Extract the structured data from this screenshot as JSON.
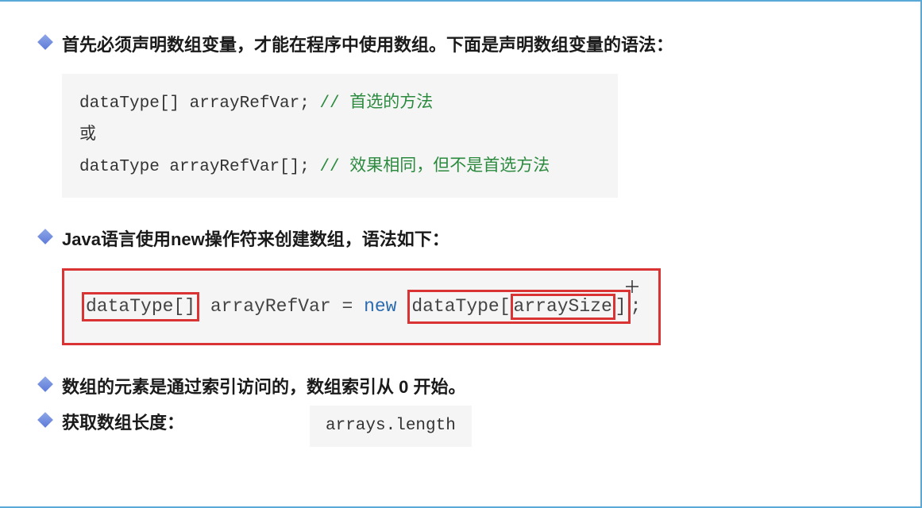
{
  "bullets": {
    "b1": "首先必须声明数组变量，才能在程序中使用数组。下面是声明数组变量的语法：",
    "b2": "Java语言使用new操作符来创建数组，语法如下：",
    "b3": "数组的元素是通过索引访问的，数组索引从 0 开始。",
    "b4": "获取数组长度："
  },
  "code1": {
    "line1": "dataType[] arrayRefVar;   ",
    "c1": "// 首选的方法",
    "line2": "或",
    "line3": "dataType arrayRefVar[];  ",
    "c3": "// 效果相同，但不是首选方法"
  },
  "code2": {
    "part1": "dataType[]",
    "part2": " arrayRefVar = ",
    "kw": "new",
    "sp": " ",
    "part3a": "dataType[",
    "part3b": "arraySize",
    "part3c": "]",
    "tail": ";"
  },
  "code3": "arrays.length"
}
